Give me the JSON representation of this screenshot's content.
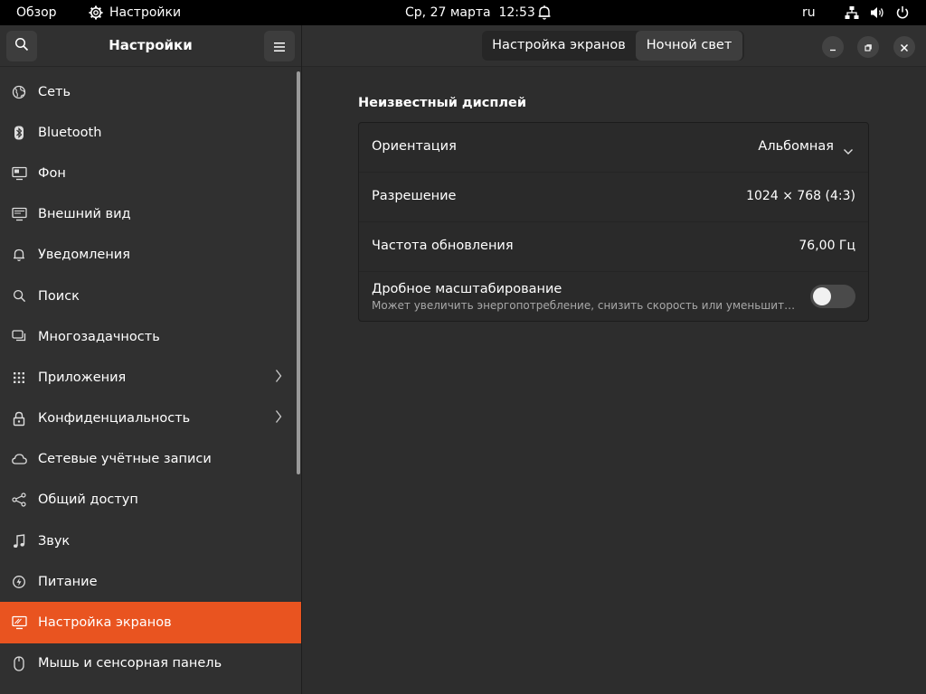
{
  "topbar": {
    "activities": "Обзор",
    "app_menu": "Настройки",
    "clock": "Ср, 27 марта  12:53",
    "keyboard_layout": "ru"
  },
  "sidebar": {
    "title": "Настройки",
    "items": [
      {
        "label": "Сеть",
        "icon": "network-globe-icon"
      },
      {
        "label": "Bluetooth",
        "icon": "bluetooth-icon"
      },
      {
        "label": "Фон",
        "icon": "background-icon"
      },
      {
        "label": "Внешний вид",
        "icon": "appearance-icon"
      },
      {
        "label": "Уведомления",
        "icon": "bell-icon"
      },
      {
        "label": "Поиск",
        "icon": "search-icon"
      },
      {
        "label": "Многозадачность",
        "icon": "multitasking-icon"
      },
      {
        "label": "Приложения",
        "icon": "apps-grid-icon"
      },
      {
        "label": "Конфиденциальность",
        "icon": "lock-icon"
      },
      {
        "label": "Сетевые учётные записи",
        "icon": "cloud-icon"
      },
      {
        "label": "Общий доступ",
        "icon": "share-icon"
      },
      {
        "label": "Звук",
        "icon": "music-note-icon"
      },
      {
        "label": "Питание",
        "icon": "power-icon"
      },
      {
        "label": "Настройка экранов",
        "icon": "display-icon"
      },
      {
        "label": "Мышь и сенсорная панель",
        "icon": "mouse-icon"
      }
    ]
  },
  "header": {
    "tabs": [
      {
        "label": "Настройка экранов"
      },
      {
        "label": "Ночной свет"
      }
    ]
  },
  "display": {
    "section_title": "Неизвестный дисплей",
    "orientation_label": "Ориентация",
    "orientation_value": "Альбомная",
    "resolution_label": "Разрешение",
    "resolution_value": "1024 × 768 (4:3)",
    "refresh_label": "Частота обновления",
    "refresh_value": "76,00 Гц",
    "scaling_label": "Дробное масштабирование",
    "scaling_description": "Может увеличить энергопотребление, снизить скорость или уменьшить резкость изображения.",
    "scaling_enabled": false
  },
  "colors": {
    "accent": "#e95420",
    "sidebar_bg": "#303030",
    "content_bg": "#2d2d2d",
    "topbar_bg": "#000000"
  }
}
